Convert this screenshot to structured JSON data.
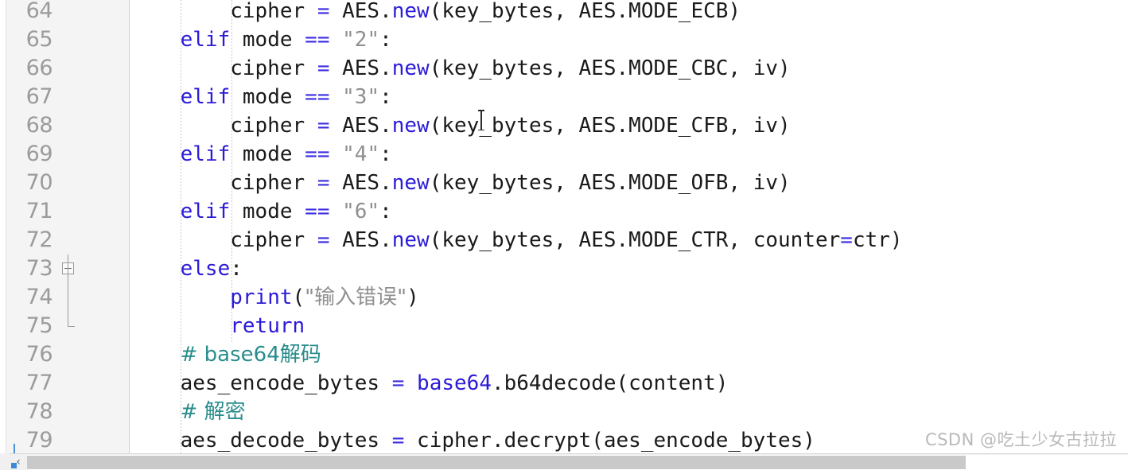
{
  "editor": {
    "language": "Python",
    "first_visible_line": 64,
    "last_visible_line": 79,
    "line_height_px": 36,
    "colors": {
      "background": "#ffffff",
      "gutter_background": "#f4f4f4",
      "line_number": "#9b9b9b",
      "keyword": "#2b1bd8",
      "operator": "#3a2be0",
      "string": "#8f8f8f",
      "comment": "#2a8c8c",
      "function": "#2b1bd8",
      "plain_text": "#1a1a1a",
      "scrollbar_thumb": "#c9c9c9",
      "vcs_stripe": "#4a90d9"
    },
    "lines": [
      {
        "number": "64",
        "indent": 2,
        "fold": "none",
        "tokens": [
          {
            "t": "        cipher ",
            "c": "plain"
          },
          {
            "t": "=",
            "c": "op"
          },
          {
            "t": " AES.",
            "c": "plain"
          },
          {
            "t": "new",
            "c": "fn"
          },
          {
            "t": "(key_bytes, AES.MODE_ECB)",
            "c": "plain"
          }
        ]
      },
      {
        "number": "65",
        "indent": 1,
        "fold": "none",
        "tokens": [
          {
            "t": "    ",
            "c": "plain"
          },
          {
            "t": "elif",
            "c": "kw"
          },
          {
            "t": " mode ",
            "c": "plain"
          },
          {
            "t": "==",
            "c": "op"
          },
          {
            "t": " ",
            "c": "plain"
          },
          {
            "t": "\"2\"",
            "c": "str"
          },
          {
            "t": ":",
            "c": "plain"
          }
        ]
      },
      {
        "number": "66",
        "indent": 2,
        "fold": "none",
        "tokens": [
          {
            "t": "        cipher ",
            "c": "plain"
          },
          {
            "t": "=",
            "c": "op"
          },
          {
            "t": " AES.",
            "c": "plain"
          },
          {
            "t": "new",
            "c": "fn"
          },
          {
            "t": "(key_bytes, AES.MODE_CBC, iv)",
            "c": "plain"
          }
        ]
      },
      {
        "number": "67",
        "indent": 1,
        "fold": "none",
        "tokens": [
          {
            "t": "    ",
            "c": "plain"
          },
          {
            "t": "elif",
            "c": "kw"
          },
          {
            "t": " mode ",
            "c": "plain"
          },
          {
            "t": "==",
            "c": "op"
          },
          {
            "t": " ",
            "c": "plain"
          },
          {
            "t": "\"3\"",
            "c": "str"
          },
          {
            "t": ":",
            "c": "plain"
          }
        ]
      },
      {
        "number": "68",
        "indent": 2,
        "fold": "none",
        "tokens": [
          {
            "t": "        cipher ",
            "c": "plain"
          },
          {
            "t": "=",
            "c": "op"
          },
          {
            "t": " AES.",
            "c": "plain"
          },
          {
            "t": "new",
            "c": "fn"
          },
          {
            "t": "(key_bytes, AES.MODE_CFB, iv)",
            "c": "plain"
          }
        ]
      },
      {
        "number": "69",
        "indent": 1,
        "fold": "none",
        "tokens": [
          {
            "t": "    ",
            "c": "plain"
          },
          {
            "t": "elif",
            "c": "kw"
          },
          {
            "t": " mode ",
            "c": "plain"
          },
          {
            "t": "==",
            "c": "op"
          },
          {
            "t": " ",
            "c": "plain"
          },
          {
            "t": "\"4\"",
            "c": "str"
          },
          {
            "t": ":",
            "c": "plain"
          }
        ]
      },
      {
        "number": "70",
        "indent": 2,
        "fold": "none",
        "tokens": [
          {
            "t": "        cipher ",
            "c": "plain"
          },
          {
            "t": "=",
            "c": "op"
          },
          {
            "t": " AES.",
            "c": "plain"
          },
          {
            "t": "new",
            "c": "fn"
          },
          {
            "t": "(key_bytes, AES.MODE_OFB, iv)",
            "c": "plain"
          }
        ]
      },
      {
        "number": "71",
        "indent": 1,
        "fold": "none",
        "tokens": [
          {
            "t": "    ",
            "c": "plain"
          },
          {
            "t": "elif",
            "c": "kw"
          },
          {
            "t": " mode ",
            "c": "plain"
          },
          {
            "t": "==",
            "c": "op"
          },
          {
            "t": " ",
            "c": "plain"
          },
          {
            "t": "\"6\"",
            "c": "str"
          },
          {
            "t": ":",
            "c": "plain"
          }
        ]
      },
      {
        "number": "72",
        "indent": 2,
        "fold": "none",
        "tokens": [
          {
            "t": "        cipher ",
            "c": "plain"
          },
          {
            "t": "=",
            "c": "op"
          },
          {
            "t": " AES.",
            "c": "plain"
          },
          {
            "t": "new",
            "c": "fn"
          },
          {
            "t": "(key_bytes, AES.MODE_CTR, counter",
            "c": "plain"
          },
          {
            "t": "=",
            "c": "op"
          },
          {
            "t": "ctr)",
            "c": "plain"
          }
        ]
      },
      {
        "number": "73",
        "indent": 1,
        "fold": "collapse",
        "tokens": [
          {
            "t": "    ",
            "c": "plain"
          },
          {
            "t": "else",
            "c": "kw"
          },
          {
            "t": ":",
            "c": "plain"
          }
        ]
      },
      {
        "number": "74",
        "indent": 2,
        "fold": "none",
        "tokens": [
          {
            "t": "        ",
            "c": "plain"
          },
          {
            "t": "print",
            "c": "fn"
          },
          {
            "t": "(",
            "c": "plain"
          },
          {
            "t": "\"输入错误\"",
            "c": "str cn"
          },
          {
            "t": ")",
            "c": "plain"
          }
        ]
      },
      {
        "number": "75",
        "indent": 2,
        "fold": "end",
        "tokens": [
          {
            "t": "        ",
            "c": "plain"
          },
          {
            "t": "return",
            "c": "kw"
          }
        ]
      },
      {
        "number": "76",
        "indent": 1,
        "fold": "none",
        "tokens": [
          {
            "t": "    ",
            "c": "plain"
          },
          {
            "t": "# base64解码",
            "c": "cmt cn"
          }
        ]
      },
      {
        "number": "77",
        "indent": 1,
        "fold": "none",
        "tokens": [
          {
            "t": "    aes_encode_bytes ",
            "c": "plain"
          },
          {
            "t": "=",
            "c": "op"
          },
          {
            "t": " ",
            "c": "plain"
          },
          {
            "t": "base64",
            "c": "mod"
          },
          {
            "t": ".b64decode(content)",
            "c": "plain"
          }
        ]
      },
      {
        "number": "78",
        "indent": 1,
        "fold": "none",
        "tokens": [
          {
            "t": "    ",
            "c": "plain"
          },
          {
            "t": "# 解密",
            "c": "cmt cn"
          }
        ]
      },
      {
        "number": "79",
        "indent": 1,
        "fold": "none",
        "tokens": [
          {
            "t": "    aes_decode_bytes ",
            "c": "plain"
          },
          {
            "t": "=",
            "c": "op"
          },
          {
            "t": " cipher.decrypt(aes_encode_bytes)",
            "c": "plain"
          }
        ]
      }
    ]
  },
  "scrollbar": {
    "left_arrow_glyph": "‹",
    "orientation": "horizontal"
  },
  "watermark": {
    "text": "CSDN @吃土少女古拉拉"
  }
}
